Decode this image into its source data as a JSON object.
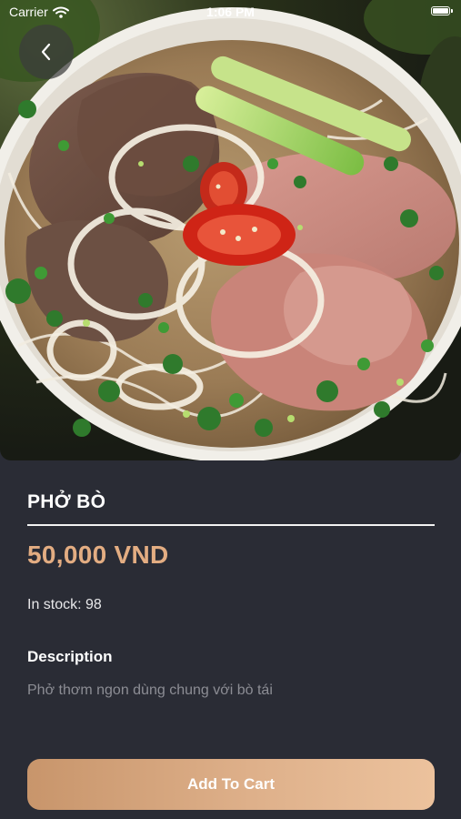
{
  "status_bar": {
    "carrier": "Carrier",
    "time": "1:06 PM"
  },
  "hero": {
    "image_alt": "Bowl of beef pho with noodles, onion rings, herbs and chili"
  },
  "product": {
    "name": "PHỞ BÒ",
    "price": "50,000 VND",
    "stock_label": "In stock:",
    "stock_count": "98",
    "description_title": "Description",
    "description": "Phở thơm ngon dùng chung với bò tái"
  },
  "actions": {
    "add_to_cart_label": "Add To Cart"
  },
  "colors": {
    "background": "#2a2c35",
    "price_accent": "#e3ad82",
    "button_gradient_start": "#c8956b",
    "button_gradient_end": "#ecc29d",
    "muted_text": "#8c8d94"
  },
  "icons": {
    "back": "chevron-left-icon",
    "wifi": "wifi-icon",
    "battery": "battery-icon"
  }
}
